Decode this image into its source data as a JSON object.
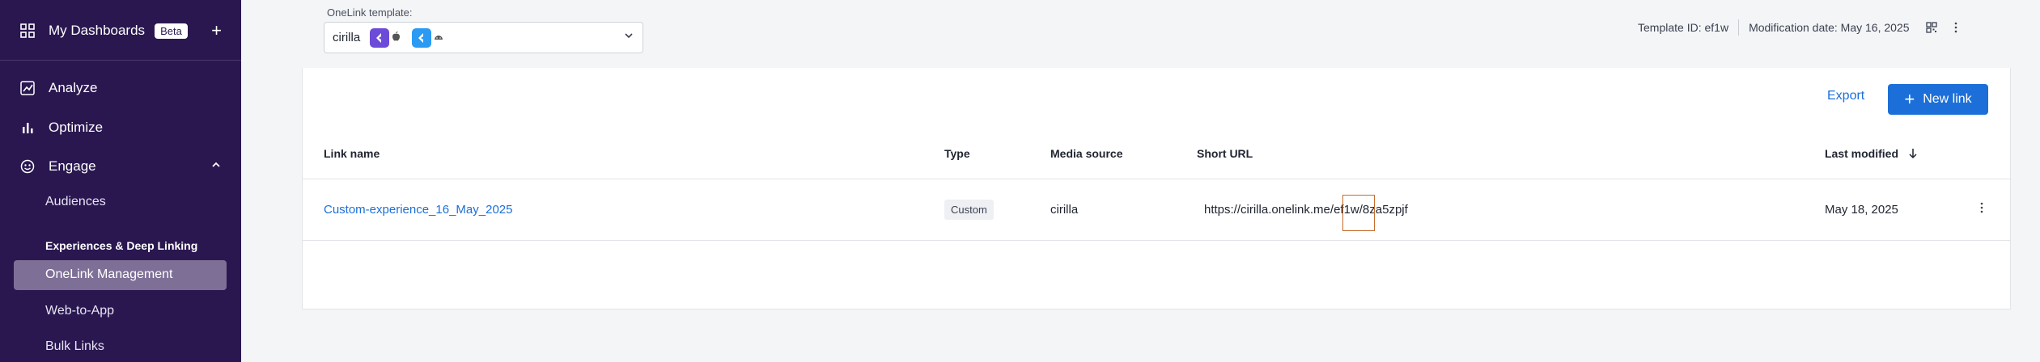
{
  "sidebar": {
    "dashboards_label": "My Dashboards",
    "beta_label": "Beta",
    "add_label": "+",
    "analyze_label": "Analyze",
    "optimize_label": "Optimize",
    "engage_label": "Engage",
    "audiences_label": "Audiences",
    "group_label": "Experiences & Deep Linking",
    "onelink_mgmt_label": "OneLink Management",
    "web_to_app_label": "Web-to-App",
    "bulk_links_label": "Bulk Links"
  },
  "template": {
    "label": "OneLink template:",
    "value": "cirilla"
  },
  "meta": {
    "template_id": "Template ID: ef1w",
    "modification_date": "Modification date: May 16, 2025"
  },
  "actions": {
    "export_label": "Export",
    "new_link_plus": "+",
    "new_link_label": "New link"
  },
  "table": {
    "headers": [
      "Link name",
      "Type",
      "Media source",
      "Short URL",
      "Last modified"
    ],
    "rows": [
      {
        "link_name": "Custom-experience_16_May_2025",
        "type": "Custom",
        "media_source": "cirilla",
        "short_url": "https://cirilla.onelink.me/ef1w/8za5zpjf",
        "last_modified": "May 18, 2025"
      }
    ]
  },
  "colors": {
    "sidebar_bg": "#2a1750",
    "accent": "#1c6fd8",
    "highlight_box": "#c46a2b"
  }
}
